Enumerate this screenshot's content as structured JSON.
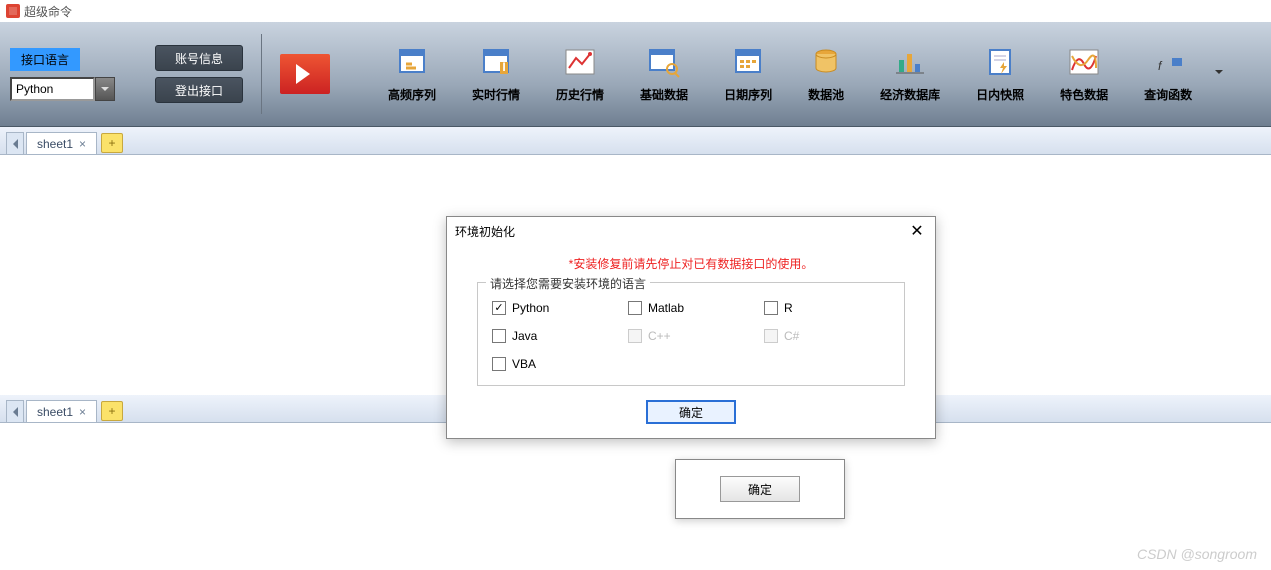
{
  "titlebar": {
    "app_name": "超级命令"
  },
  "ribbon": {
    "lang_label": "接口语言",
    "lang_value": "Python",
    "account_btn": "账号信息",
    "logout_btn": "登出接口",
    "tools": [
      {
        "key": "highfreq",
        "label": "高频序列"
      },
      {
        "key": "realtime",
        "label": "实时行情"
      },
      {
        "key": "history",
        "label": "历史行情"
      },
      {
        "key": "basic",
        "label": "基础数据"
      },
      {
        "key": "dateseq",
        "label": "日期序列"
      },
      {
        "key": "pool",
        "label": "数据池"
      },
      {
        "key": "econdb",
        "label": "经济数据库"
      },
      {
        "key": "snapshot",
        "label": "日内快照"
      },
      {
        "key": "special",
        "label": "特色数据"
      },
      {
        "key": "formula",
        "label": "查询函数"
      }
    ]
  },
  "tabs": {
    "strip1": {
      "tab_label": "sheet1",
      "add_label": "+"
    },
    "strip2": {
      "tab_label": "sheet1",
      "add_label": "+"
    }
  },
  "dialog": {
    "title": "环境初始化",
    "warning": "*安装修复前请先停止对已有数据接口的使用。",
    "legend": "请选择您需要安装环境的语言",
    "options": [
      {
        "label": "Python",
        "checked": true,
        "disabled": false
      },
      {
        "label": "Matlab",
        "checked": false,
        "disabled": false
      },
      {
        "label": "R",
        "checked": false,
        "disabled": false
      },
      {
        "label": "Java",
        "checked": false,
        "disabled": false
      },
      {
        "label": "C++",
        "checked": false,
        "disabled": true
      },
      {
        "label": "C#",
        "checked": false,
        "disabled": true
      },
      {
        "label": "VBA",
        "checked": false,
        "disabled": false
      }
    ],
    "ok_label": "确定"
  },
  "sub_dialog": {
    "ok_label": "确定"
  },
  "watermark": "CSDN @songroom"
}
